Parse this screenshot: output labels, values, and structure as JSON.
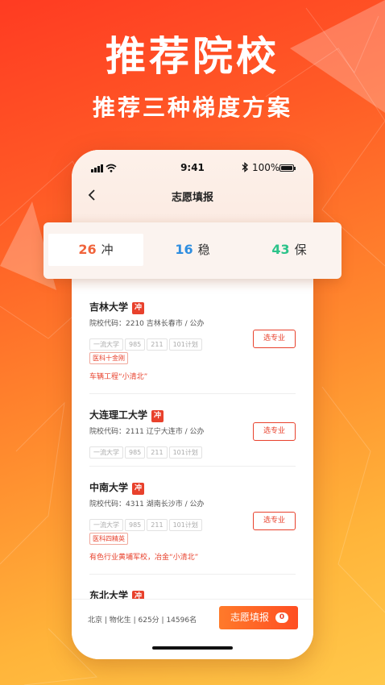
{
  "hero": {
    "title": "推荐院校",
    "subtitle": "推荐三种梯度方案"
  },
  "status_bar": {
    "time": "9:41",
    "battery": "100%"
  },
  "nav": {
    "title": "志愿填报",
    "back_icon": "chevron-left-icon"
  },
  "tabs": [
    {
      "count": "26",
      "label": "冲",
      "color": "#f0643c",
      "active": true
    },
    {
      "count": "16",
      "label": "稳",
      "color": "#2f8ee0",
      "active": false
    },
    {
      "count": "43",
      "label": "保",
      "color": "#2cc38a",
      "active": false
    }
  ],
  "universities": [
    {
      "name": "吉林大学",
      "badge": "冲",
      "code": "院校代码：2210  吉林长春市 / 公办",
      "tags": [
        "一流大学",
        "985",
        "211",
        "101计划"
      ],
      "feature": "医科十金刚",
      "note": "车辆工程“小清北”",
      "button": "选专业"
    },
    {
      "name": "大连理工大学",
      "badge": "冲",
      "code": "院校代码：2111  辽宁大连市 / 公办",
      "tags": [
        "一流大学",
        "985",
        "211",
        "101计划"
      ],
      "button": "选专业"
    },
    {
      "name": "中南大学",
      "badge": "冲",
      "code": "院校代码：4311  湖南长沙市 / 公办",
      "tags": [
        "一流大学",
        "985",
        "211",
        "101计划"
      ],
      "feature": "医科四精英",
      "note": "有色行业黄埔军校，冶金“小清北”",
      "button": "选专业"
    },
    {
      "name": "东北大学",
      "badge": "冲"
    }
  ],
  "bottom": {
    "info": "北京 | 物化生 | 625分 | 14596名",
    "button": "志愿填报",
    "count": "0"
  },
  "colors": {
    "accent": "#e8412c",
    "brand_gradient_start": "#ff3b22",
    "brand_gradient_end": "#ffc84a"
  }
}
